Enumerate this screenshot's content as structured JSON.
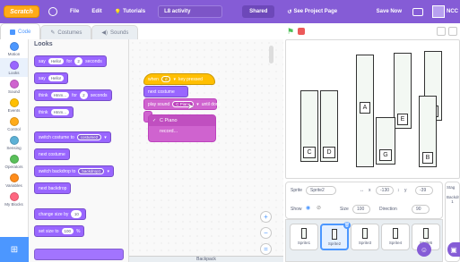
{
  "menubar": {
    "logo": "Scratch",
    "file": "File",
    "edit": "Edit",
    "tutorials": "Tutorials",
    "project_title": "L8 activity",
    "shared": "Shared",
    "see_project": "See Project Page",
    "save": "Save Now",
    "user": "NCC"
  },
  "tabs": [
    {
      "label": "Code"
    },
    {
      "label": "Costumes"
    },
    {
      "label": "Sounds"
    }
  ],
  "categories": [
    {
      "label": "Motion",
      "color": "#4c97ff"
    },
    {
      "label": "Looks",
      "color": "#9966ff"
    },
    {
      "label": "Sound",
      "color": "#cf63cf"
    },
    {
      "label": "Events",
      "color": "#ffbf00"
    },
    {
      "label": "Control",
      "color": "#ffab19"
    },
    {
      "label": "Sensing",
      "color": "#5cb1d6"
    },
    {
      "label": "Operators",
      "color": "#59c059"
    },
    {
      "label": "Variables",
      "color": "#ff8c1a"
    },
    {
      "label": "My Blocks",
      "color": "#ff6680"
    }
  ],
  "palette": {
    "title": "Looks",
    "blocks": {
      "say_for": {
        "a": "say",
        "v1": "Hello!",
        "b": "for",
        "v2": "2",
        "c": "seconds"
      },
      "say": {
        "a": "say",
        "v1": "Hello!"
      },
      "think_for": {
        "a": "think",
        "v1": "Hmm...",
        "b": "for",
        "v2": "2",
        "c": "seconds"
      },
      "think": {
        "a": "think",
        "v1": "Hmm..."
      },
      "switch_costume": {
        "a": "switch costume to",
        "v1": "costume2"
      },
      "next_costume": "next costume",
      "switch_backdrop": {
        "a": "switch backdrop to",
        "v1": "backdrop1"
      },
      "next_backdrop": "next backdrop",
      "change_size": {
        "a": "change size by",
        "v1": "10"
      },
      "set_size": {
        "a": "set size to",
        "v1": "100",
        "b": "%"
      }
    }
  },
  "script": {
    "hat": {
      "a": "when",
      "v1": "d",
      "b": "key pressed"
    },
    "next_costume": "next costume",
    "play_sound": {
      "a": "play sound",
      "v1": "C Piano",
      "b": "until done"
    },
    "dropdown": [
      "C Piano",
      "record..."
    ]
  },
  "backpack": "Backpack",
  "stage": {
    "keys": [
      "A",
      "E",
      "F",
      "C",
      "D",
      "G",
      "B"
    ]
  },
  "sprite_info": {
    "sprite_label": "Sprite",
    "sprite_name": "Sprite2",
    "x_label": "x",
    "x_value": "-130",
    "y_label": "y",
    "y_value": "-39",
    "show_label": "Show",
    "size_label": "Size",
    "size_value": "100",
    "direction_label": "Direction",
    "direction_value": "90"
  },
  "sprites": [
    "Sprite1",
    "Sprite2",
    "Sprite3",
    "Sprite4",
    "Sprite5"
  ],
  "stage_panel": {
    "label": "Stag",
    "backdrops_label": "Backdr",
    "count": "1"
  }
}
